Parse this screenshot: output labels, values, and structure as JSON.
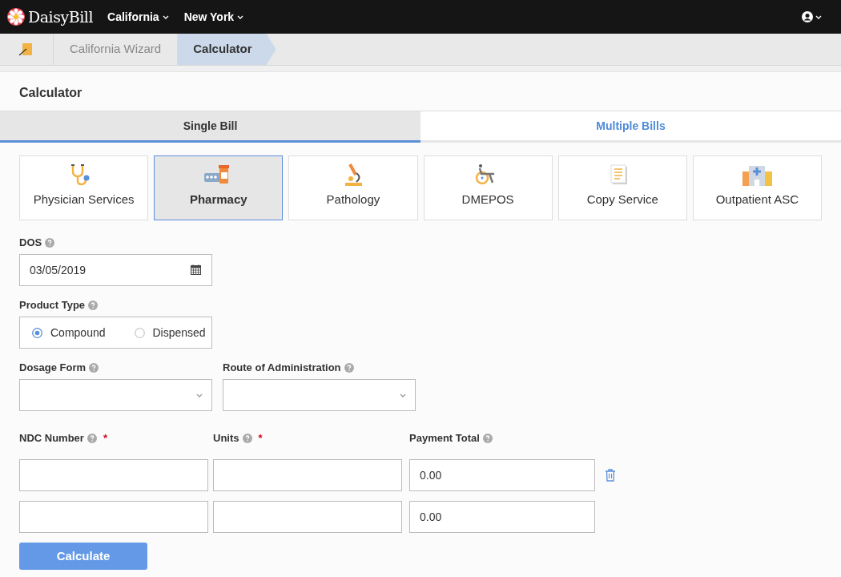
{
  "navbar": {
    "brand": "DaisyBill",
    "menus": [
      {
        "label": "California"
      },
      {
        "label": "New York"
      }
    ]
  },
  "breadcrumb": [
    {
      "label": "California Wizard",
      "selected": false
    },
    {
      "label": "Calculator",
      "selected": true
    }
  ],
  "page_title": "Calculator",
  "tabs": [
    {
      "label": "Single Bill",
      "selected": true
    },
    {
      "label": "Multiple Bills",
      "selected": false
    }
  ],
  "categories": [
    {
      "label": "Physician Services",
      "selected": false
    },
    {
      "label": "Pharmacy",
      "selected": true
    },
    {
      "label": "Pathology",
      "selected": false
    },
    {
      "label": "DMEPOS",
      "selected": false
    },
    {
      "label": "Copy Service",
      "selected": false
    },
    {
      "label": "Outpatient ASC",
      "selected": false
    }
  ],
  "dos": {
    "label": "DOS",
    "value": "03/05/2019"
  },
  "product_type": {
    "label": "Product Type",
    "options": [
      {
        "label": "Compound",
        "selected": true
      },
      {
        "label": "Dispensed",
        "selected": false
      }
    ]
  },
  "dosage_form": {
    "label": "Dosage Form"
  },
  "route": {
    "label": "Route of Administration"
  },
  "line_columns": [
    {
      "label": "NDC Number",
      "required_mark": "*"
    },
    {
      "label": "Units",
      "required_mark": "*"
    },
    {
      "label": "Payment Total"
    }
  ],
  "line_rows": [
    {
      "payment_total": "0.00",
      "deletable": true
    },
    {
      "payment_total": "0.00",
      "deletable": false
    }
  ],
  "calculate_button": "Calculate"
}
